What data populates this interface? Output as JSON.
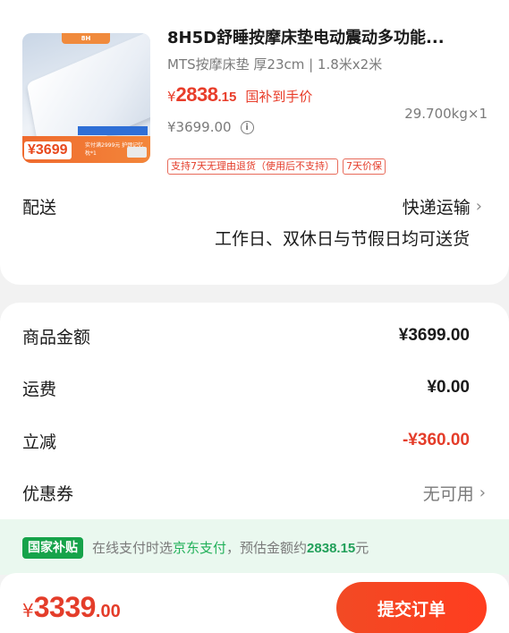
{
  "product": {
    "title": "8H5D舒睡按摩床垫电动震动多功能...",
    "spec": "MTS按摩床垫 厚23cm | 1.8米x2米",
    "price_currency": "¥",
    "price_integer": "2838",
    "price_decimal": ".15",
    "price_note": "国补到手价",
    "original_price": "¥3699.00",
    "weight_qty": "29.700kg×1",
    "tags": [
      "支持7天无理由退货（使用后不支持）",
      "7天价保"
    ],
    "image": {
      "brand_chip": "8H",
      "price_chip": "¥3699",
      "promo_text": "实付满2999元 护颈记忆枕*1"
    }
  },
  "delivery": {
    "label": "配送",
    "method": "快递运输",
    "time": "工作日、双休日与节假日均可送货"
  },
  "summary": {
    "goods_label": "商品金额",
    "goods_value": "¥3699.00",
    "shipping_label": "运费",
    "shipping_value": "¥0.00",
    "discount_label": "立减",
    "discount_value": "-¥360.00",
    "coupon_label": "优惠券",
    "coupon_value": "无可用"
  },
  "subsidy": {
    "badge": "国家补贴",
    "text_before": "在线支付时选",
    "pay_method": "京东支付",
    "text_middle": "，预估金额约",
    "amount": "2838.15",
    "text_after": "元"
  },
  "footer": {
    "total_currency": "¥",
    "total_integer": "3339",
    "total_decimal": ".00",
    "submit_label": "提交订单"
  },
  "colors": {
    "accent_red": "#e43d2a",
    "subsidy_green": "#16a34a",
    "submit_gradient_start": "#f24a24"
  }
}
